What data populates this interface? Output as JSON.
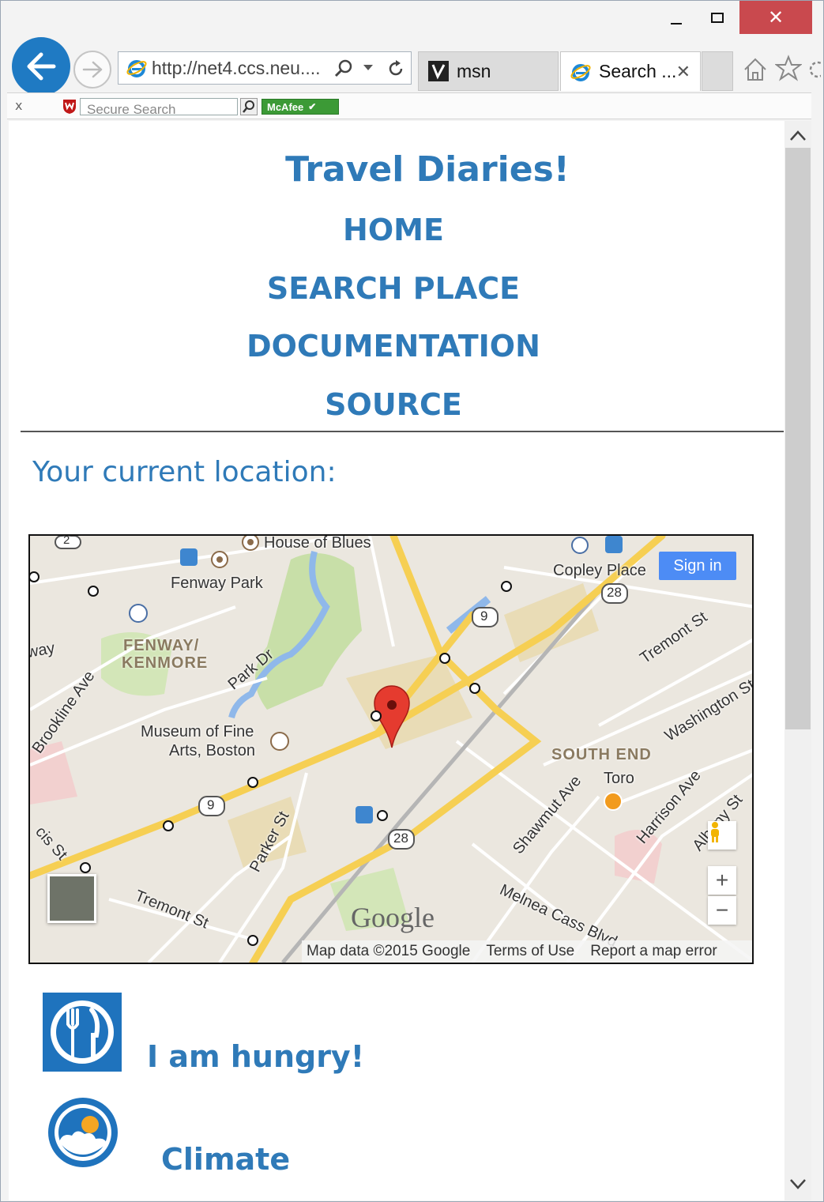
{
  "browser": {
    "address_url": "http://net4.ccs.neu....",
    "tabs": [
      {
        "label": "msn"
      },
      {
        "label": "Search ..."
      }
    ],
    "toolbar": {
      "close_label": "x",
      "search_placeholder": "Secure Search",
      "mcafee_label": "McAfee"
    }
  },
  "site": {
    "title": "Travel Diaries!",
    "nav": [
      "HOME",
      "SEARCH PLACE",
      "DOCUMENTATION",
      "SOURCE"
    ],
    "location_heading": "Your current location:"
  },
  "map": {
    "labels": {
      "house_of_blues": "House of Blues",
      "fenway_park": "Fenway Park",
      "copley_place": "Copley Place",
      "fenway_kenmore_1": "FENWAY/",
      "fenway_kenmore_2": "KENMORE",
      "park_dr": "Park Dr",
      "brookline_ave": "Brookline Ave",
      "museum_1": "Museum of Fine",
      "museum_2": "Arts, Boston",
      "tremont_st_ne": "Tremont St",
      "washington_st": "Washington St",
      "south_end": "SOUTH END",
      "toro": "Toro",
      "shawmut_ave": "Shawmut Ave",
      "harrison_ave": "Harrison Ave",
      "parker_st": "Parker St",
      "tremont_st_sw": "Tremont St",
      "melnea_cass": "Melnea Cass Blvd",
      "albany_st": "Albany St",
      "way": "way",
      "cis_st": "cis St",
      "road_9_a": "9",
      "road_9_b": "9",
      "road_28_a": "28",
      "road_28_b": "28",
      "road_2": "2"
    },
    "sign_in": "Sign in",
    "zoom_in": "+",
    "zoom_out": "−",
    "google": "Google",
    "footer": [
      "Map data ©2015 Google",
      "Terms of Use",
      "Report a map error"
    ]
  },
  "features": [
    {
      "label": "I am hungry!",
      "icon": "fork-knife-icon"
    },
    {
      "label": "Climate",
      "icon": "sun-cloud-icon"
    }
  ],
  "colors": {
    "accent": "#2f7ab8",
    "back_button": "#1f7ac3",
    "close_button": "#c9494e",
    "sign_in": "#4d8cf5",
    "map_pin": "#e53b2f"
  }
}
